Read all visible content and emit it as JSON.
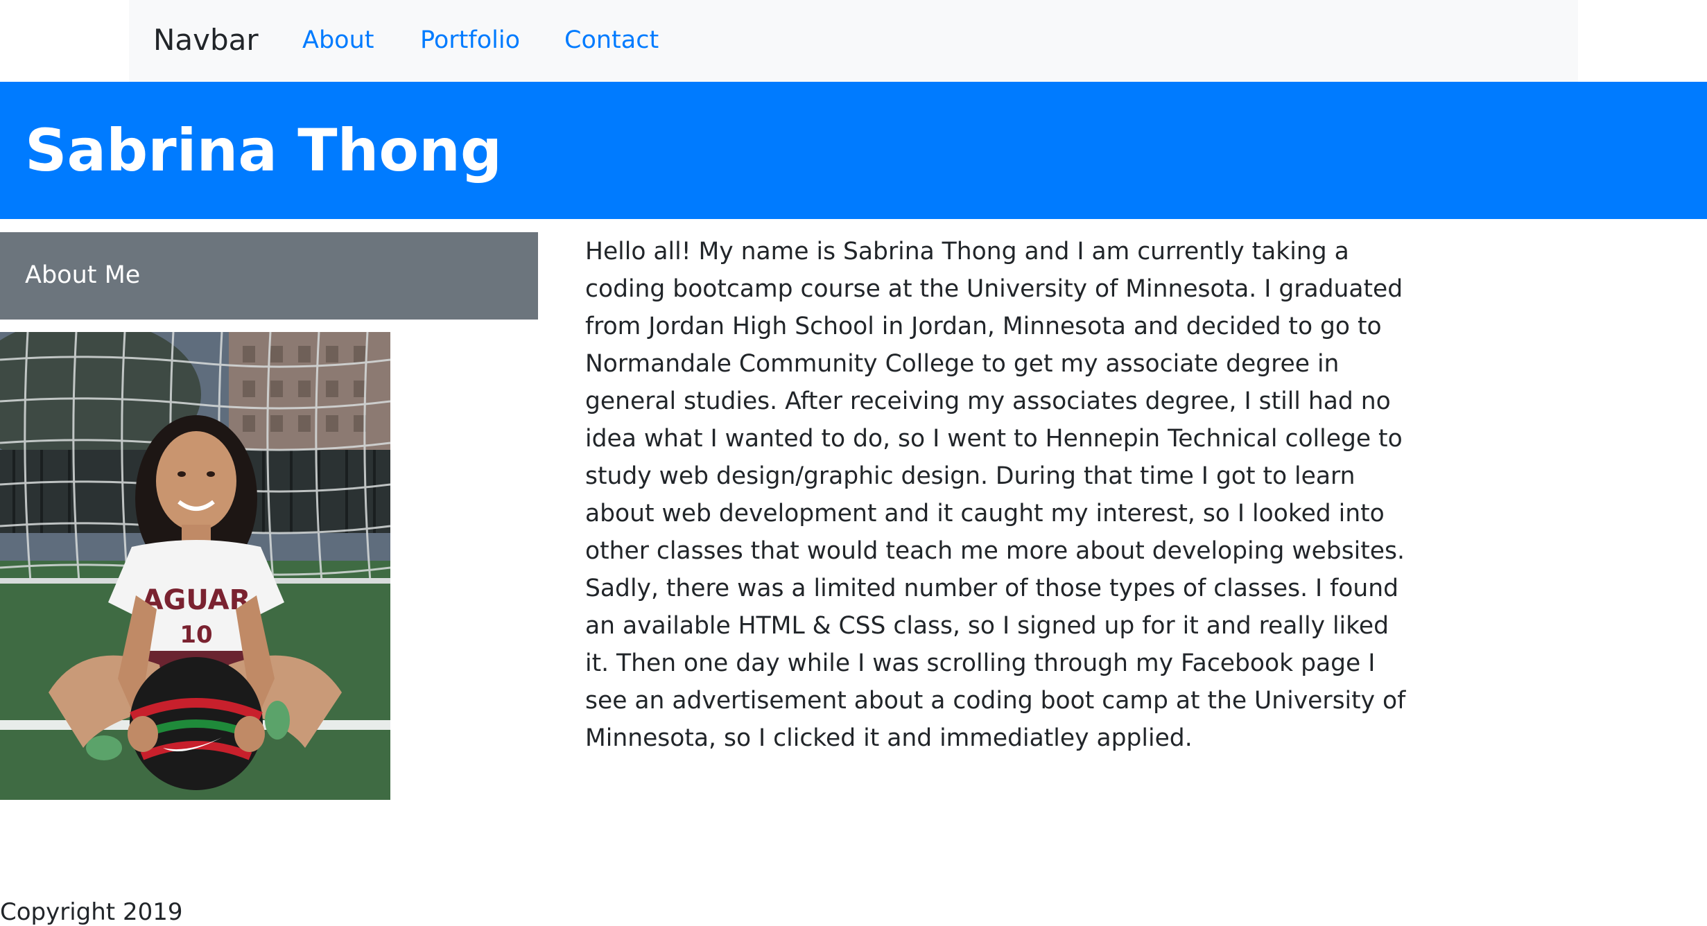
{
  "navbar": {
    "brand": "Navbar",
    "links": [
      "About",
      "Portfolio",
      "Contact"
    ],
    "link_color": "#007bff",
    "background": "#f8f9fa"
  },
  "header": {
    "title": "Sabrina Thong",
    "background": "#007bff"
  },
  "about_card": {
    "title": "About Me",
    "background": "#6c757d"
  },
  "bio": {
    "text": "Hello all! My name is Sabrina Thong and I am currently taking a coding bootcamp course at the University of Minnesota. I graduated from Jordan High School in Jordan, Minnesota and decided to go to Normandale Community College to get my associate degree in general studies. After receiving my associates degree, I still had no idea what I wanted to do, so I went to Hennepin Technical college to study web design/graphic design. During that time I got to learn about web development and it caught my interest, so I looked into other classes that would teach me more about developing websites. Sadly, there was a limited number of those types of classes. I found an available HTML & CSS class, so I signed up for it and really liked it. Then one day while I was scrolling through my Facebook page I see an advertisement about a coding boot camp at the University of Minnesota, so I clicked it and immediatley applied."
  },
  "photo": {
    "jersey_text": "AGUAR",
    "jersey_number": "10"
  },
  "footer": {
    "text": "Copyright 2019"
  }
}
